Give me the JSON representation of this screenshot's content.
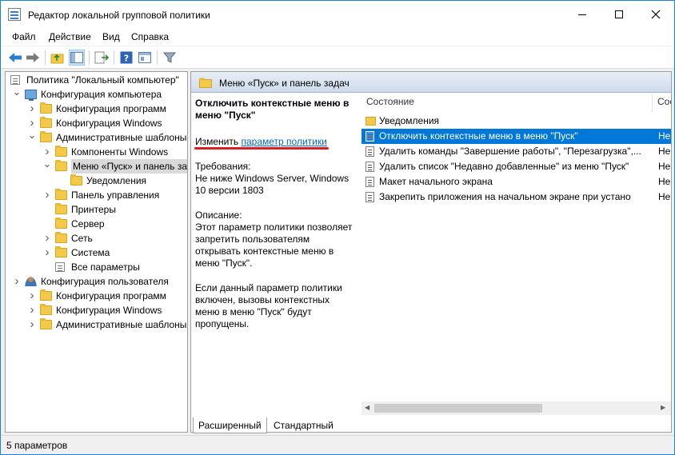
{
  "window": {
    "title": "Редактор локальной групповой политики"
  },
  "menu": [
    "Файл",
    "Действие",
    "Вид",
    "Справка"
  ],
  "tree": [
    {
      "label": "Политика \"Локальный компьютер\"",
      "icon": "doc-icon",
      "level": 0,
      "arrow": ""
    },
    {
      "label": "Конфигурация компьютера",
      "icon": "computer-icon",
      "level": 1,
      "arrow": "down"
    },
    {
      "label": "Конфигурация программ",
      "icon": "folder-icon",
      "level": 2,
      "arrow": "right"
    },
    {
      "label": "Конфигурация Windows",
      "icon": "folder-icon",
      "level": 2,
      "arrow": "right"
    },
    {
      "label": "Административные шаблоны",
      "icon": "folder-icon",
      "level": 2,
      "arrow": "down"
    },
    {
      "label": "Компоненты Windows",
      "icon": "folder-icon",
      "level": 3,
      "arrow": "right"
    },
    {
      "label": "Меню «Пуск» и панель задач",
      "icon": "folder-icon",
      "level": 3,
      "arrow": "down",
      "selected": true
    },
    {
      "label": "Уведомления",
      "icon": "folder-icon",
      "level": 4,
      "arrow": ""
    },
    {
      "label": "Панель управления",
      "icon": "folder-icon",
      "level": 3,
      "arrow": "right"
    },
    {
      "label": "Принтеры",
      "icon": "folder-icon",
      "level": 3,
      "arrow": ""
    },
    {
      "label": "Сервер",
      "icon": "folder-icon",
      "level": 3,
      "arrow": ""
    },
    {
      "label": "Сеть",
      "icon": "folder-icon",
      "level": 3,
      "arrow": "right"
    },
    {
      "label": "Система",
      "icon": "folder-icon",
      "level": 3,
      "arrow": "right"
    },
    {
      "label": "Все параметры",
      "icon": "doc-icon",
      "level": 3,
      "arrow": ""
    },
    {
      "label": "Конфигурация пользователя",
      "icon": "user-icon",
      "level": 1,
      "arrow": "right-open"
    },
    {
      "label": "Конфигурация программ",
      "icon": "folder-icon",
      "level": 2,
      "arrow": "right"
    },
    {
      "label": "Конфигурация Windows",
      "icon": "folder-icon",
      "level": 2,
      "arrow": "right"
    },
    {
      "label": "Административные шаблоны",
      "icon": "folder-icon",
      "level": 2,
      "arrow": "right"
    }
  ],
  "details": {
    "header_title": "Меню «Пуск» и панель задач",
    "policy_title": "Отключить контекстные меню в меню \"Пуск\"",
    "edit_prefix": "Изменить",
    "edit_link": "параметр политики",
    "requirements_label": "Требования:",
    "requirements_text": "Не ниже Windows Server, Windows 10 версии 1803",
    "description_label": "Описание:",
    "description_text": "Этот параметр политики позволяет запретить пользователям открывать контекстные меню в меню \"Пуск\".",
    "description_text2": "Если данный параметр политики включен, вызовы контекстных меню в меню \"Пуск\" будут пропущены."
  },
  "list": {
    "columns": [
      "Состояние",
      "Сос"
    ],
    "rows": [
      {
        "name": "Уведомления",
        "type": "folder",
        "state": ""
      },
      {
        "name": "Отключить контекстные меню в меню \"Пуск\"",
        "type": "setting",
        "state": "Не",
        "selected": true
      },
      {
        "name": "Удалить команды \"Завершение работы\", \"Перезагрузка\",...",
        "type": "setting",
        "state": "Не"
      },
      {
        "name": "Удалить список \"Недавно добавленные\" из меню \"Пуск\"",
        "type": "setting",
        "state": "Не"
      },
      {
        "name": "Макет начального экрана",
        "type": "setting",
        "state": "Не"
      },
      {
        "name": "Закрепить приложения на начальном экране при устано",
        "type": "setting",
        "state": "Не"
      }
    ]
  },
  "tabs": [
    "Расширенный",
    "Стандартный"
  ],
  "status": "5 параметров"
}
